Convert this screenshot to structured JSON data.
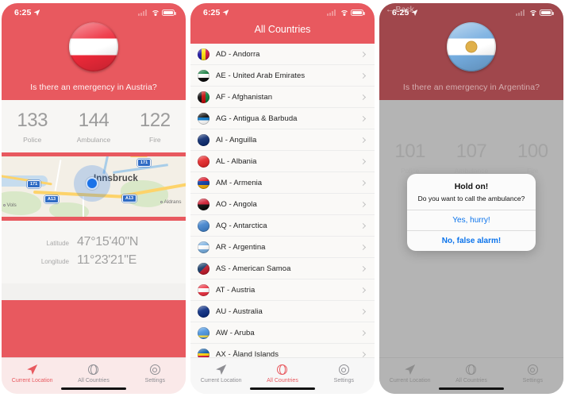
{
  "status_bar": {
    "time": "6:25",
    "location_icon": "location-arrow-icon",
    "wifi_icon": "wifi-icon",
    "battery_icon": "battery-icon"
  },
  "colors": {
    "brand_red": "#e8595f",
    "dim_red": "#a0474c",
    "panel_bg": "#f7f6f4",
    "link_blue": "#0a73ec",
    "inactive_gray": "#8e8e93"
  },
  "panel1": {
    "name": "current-location-screen",
    "flag": "austria-flag",
    "question": "Is there an emergency in Austria?",
    "numbers": [
      {
        "value": "133",
        "label": "Police"
      },
      {
        "value": "144",
        "label": "Ambulance"
      },
      {
        "value": "122",
        "label": "Fire"
      }
    ],
    "map": {
      "city": "Innsbruck",
      "towns": [
        "Vols",
        "Aldrans"
      ],
      "road_shields": [
        "171",
        "171",
        "A13",
        "A13"
      ]
    },
    "coords": [
      {
        "label": "Latitude",
        "value": "47°15'40\"N"
      },
      {
        "label": "Longitude",
        "value": "11°23'21\"E"
      }
    ]
  },
  "panel2": {
    "name": "all-countries-screen",
    "title": "All Countries",
    "countries": [
      {
        "label": "AD - Andorra",
        "flag": "andorra-flag"
      },
      {
        "label": "AE - United Arab Emirates",
        "flag": "uae-flag"
      },
      {
        "label": "AF - Afghanistan",
        "flag": "afghanistan-flag"
      },
      {
        "label": "AG - Antigua & Barbuda",
        "flag": "antigua-barbuda-flag"
      },
      {
        "label": "AI - Anguilla",
        "flag": "anguilla-flag"
      },
      {
        "label": "AL - Albania",
        "flag": "albania-flag"
      },
      {
        "label": "AM - Armenia",
        "flag": "armenia-flag"
      },
      {
        "label": "AO - Angola",
        "flag": "angola-flag"
      },
      {
        "label": "AQ - Antarctica",
        "flag": "antarctica-flag"
      },
      {
        "label": "AR - Argentina",
        "flag": "argentina-flag"
      },
      {
        "label": "AS - American Samoa",
        "flag": "american-samoa-flag"
      },
      {
        "label": "AT - Austria",
        "flag": "austria-flag"
      },
      {
        "label": "AU - Australia",
        "flag": "australia-flag"
      },
      {
        "label": "AW - Aruba",
        "flag": "aruba-flag"
      },
      {
        "label": "AX - Åland Islands",
        "flag": "aland-islands-flag"
      }
    ]
  },
  "panel3": {
    "name": "country-detail-screen",
    "back_label": "Back",
    "flag": "argentina-flag",
    "question": "Is there an emergency in Argentina?",
    "numbers": [
      {
        "value": "101",
        "label": "Police"
      },
      {
        "value": "107",
        "label": "Ambulance"
      },
      {
        "value": "100",
        "label": "Fire"
      }
    ],
    "alert": {
      "title": "Hold on!",
      "message": "Do you want to call the ambulance?",
      "confirm_label": "Yes, hurry!",
      "cancel_label": "No, false alarm!"
    }
  },
  "tabs": [
    {
      "label": "Current Location",
      "icon": "navigation-arrow-icon"
    },
    {
      "label": "All Countries",
      "icon": "globe-icon"
    },
    {
      "label": "Settings",
      "icon": "gear-icon"
    }
  ]
}
